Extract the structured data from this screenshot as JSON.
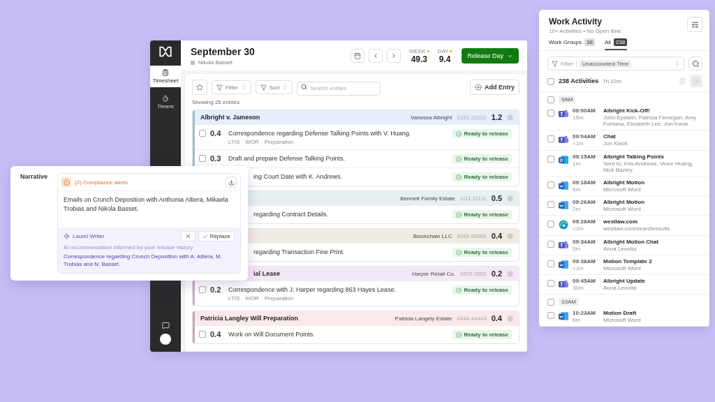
{
  "sidebar": [
    {
      "label": "Timesheet",
      "kind": "timesheet",
      "selected": true
    },
    {
      "label": "Timers",
      "kind": "timers",
      "selected": false
    }
  ],
  "header": {
    "title": "September 30",
    "user": "Nikola Basset",
    "stats": [
      {
        "label": "WEEK",
        "value": "49.3"
      },
      {
        "label": "DAY",
        "value": "9.4"
      }
    ],
    "release_button": "Release Day"
  },
  "toolbar": {
    "filter": "Filter",
    "sort": "Sort",
    "search_placeholder": "Search entries",
    "add_button": "Add Entry"
  },
  "entry_count": "Showing 25 entries",
  "groups": [
    {
      "title": "Albright v. Jameson",
      "client": "Vanessa Albright",
      "number": "2222.22222",
      "hours": "1.2",
      "color": "#e6eefb",
      "entries": [
        {
          "checked": false,
          "hours": "0.4",
          "text": "Correspondence regarding Defense Talking Points with V. Huang.",
          "tags": [
            "LTIS",
            "WOR",
            "Preparation"
          ],
          "status": "Ready to release"
        },
        {
          "checked": false,
          "hours": "0.3",
          "text": "Draft and prepare Defense Talking Points.",
          "status": "Ready to release"
        },
        {
          "text": "ing Court Date with K. Andrews.",
          "status": "Ready to release"
        }
      ]
    },
    {
      "client": "Bennett Family Estate",
      "number": "1111.11111",
      "hours": "0.5",
      "color": "#e8eff1",
      "entries": [
        {
          "text": "regarding Contract Details.",
          "status": "Ready to release"
        }
      ]
    },
    {
      "client": "Blockchain LLC",
      "number": "8888.88888",
      "hours": "0.4",
      "color": "#efebe4",
      "entries": [
        {
          "text": "regarding Transaction Fine Print.",
          "status": "Ready to release"
        }
      ]
    },
    {
      "title": "ial Lease",
      "title_covered": true,
      "client": "Harper Retail Co.",
      "number": "5555.5555",
      "hours": "0.2",
      "color": "#f3e8f8",
      "entries": [
        {
          "checked": false,
          "hours": "0.2",
          "text": "Correspondence with J. Harper regarding 863 Hayes Lease.",
          "tags": [
            "LTIS",
            "WOR",
            "Preparation"
          ],
          "status": "Ready to release"
        }
      ]
    },
    {
      "title": "Patricia Langley Will Preparation",
      "client": "Patricia Langely Estate",
      "number": "4444.44444",
      "hours": "0.4",
      "color": "#fbe8ea",
      "entries": [
        {
          "checked": false,
          "hours": "0.4",
          "text": "Work on Will Document Points.",
          "status": "Ready to release"
        }
      ]
    }
  ],
  "narrative": {
    "label": "Narrative",
    "alerts": "(2) Compliance alerts",
    "text": "Emails on Crunch Deposition with Anthonia Altiera, Mikaela Trobias and Nikola Basset.",
    "writer": "Laurel Writer",
    "replace_button": "Replace",
    "hint": "AI recommendation informed by your release history",
    "suggestion": "Correspondence regarding Crunch Deposition with A. Altiera, M. Trobias and N. Basset."
  },
  "work_activity": {
    "title": "Work Activity",
    "subtitle": "10+ Activities • No Open time",
    "tabs": [
      {
        "label": "Work Groups",
        "count": "38",
        "selected": false
      },
      {
        "label": "All",
        "count": "238",
        "selected": true
      }
    ],
    "filter": "Filter",
    "filter_value": "Unaccounted Time",
    "total": "238 Activities",
    "duration": "7h 22m",
    "all_checked": false,
    "sections": [
      {
        "hour": "9AM",
        "checked": false,
        "items": [
          {
            "kind": "teams",
            "checked": false,
            "time": "09:00AM",
            "length": "15m",
            "title": "Albright Kick-Off!",
            "detail": "John Epstein, Patricia Finnegan, Amy Fontana, Elizabeth Lee, Jon Kwok"
          },
          {
            "kind": "teams",
            "checked": false,
            "time": "09:04AM",
            "length": "<1m",
            "title": "Chat",
            "detail": "Jon Kwok"
          },
          {
            "kind": "outlook",
            "checked": false,
            "time": "09:15AM",
            "length": "1m",
            "title": "Albright Talking Points",
            "detail": "Sent to: Kris Andrews, Vince Huang, Nick Bazley"
          },
          {
            "kind": "word",
            "checked": false,
            "time": "09:18AM",
            "length": "6m",
            "title": "Albright Motion",
            "detail": "Microsoft Word"
          },
          {
            "kind": "word",
            "checked": false,
            "time": "09:26AM",
            "length": "2m",
            "title": "Albright Motion",
            "detail": "Microsoft Word"
          },
          {
            "kind": "edge",
            "checked": false,
            "time": "09:28AM",
            "length": "<1m",
            "title": "westlaw.com",
            "detail": "westlaw.com/searchresults"
          },
          {
            "kind": "teams",
            "checked": false,
            "time": "09:34AM",
            "length": "5m",
            "title": "Albright Motion Chat",
            "detail": "Anna Leonita"
          },
          {
            "kind": "word",
            "checked": false,
            "time": "09:38AM",
            "length": "<1m",
            "title": "Motion Template 2",
            "detail": "Microsoft Word"
          },
          {
            "kind": "teams",
            "checked": false,
            "time": "09:45AM",
            "length": "30m",
            "title": "Albright Update",
            "detail": "Anna Leonita"
          }
        ]
      },
      {
        "hour": "10AM",
        "checked": false,
        "items": [
          {
            "kind": "word",
            "checked": false,
            "time": "10:23AM",
            "length": "6m",
            "title": "Motion Draft",
            "detail": "Microsoft Word"
          }
        ]
      }
    ]
  }
}
